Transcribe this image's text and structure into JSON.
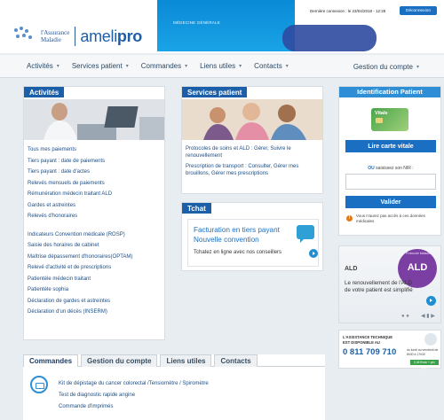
{
  "header": {
    "logo_line1": "l'Assurance",
    "logo_line2": "Maladie",
    "logo_brand_a": "ameli",
    "logo_brand_b": "pro",
    "specialty": "MÉDECINE GÉNÉRALE",
    "last_connection": "Dernière connexion : le 23/04/2018 - 12:26",
    "logout_label": "Déconnexion"
  },
  "nav": {
    "items": [
      {
        "label": "Activités"
      },
      {
        "label": "Services patient"
      },
      {
        "label": "Commandes"
      },
      {
        "label": "Liens utiles"
      },
      {
        "label": "Contacts"
      }
    ],
    "account_label": "Gestion du compte"
  },
  "activities": {
    "title": "Activités",
    "links": [
      "Tous mes paiements",
      "Tiers payant : date de paiements",
      "Tiers payant : date d'actes",
      "Relevés mensuels de paiements",
      "Rémunération médecin traitant ALD",
      "Gardes et astreintes",
      "Relevés d'honoraires"
    ],
    "links2": [
      "Indicateurs Convention médicale (ROSP)",
      "Saisie des horaires de cabinet",
      "Maîtrise dépassement d'honoraires(OPTAM)",
      "Relevé d'activité et de prescriptions",
      "Patientèle médecin traitant",
      "Patientèle sophia",
      "Déclaration de gardes et astreintes",
      "Déclaration d'un décès (INSERM)"
    ]
  },
  "services": {
    "title": "Services patient",
    "text1": "Protocoles de soins et ALD : Gérer, Suivre le renouvellement",
    "text2": "Prescription de transport : Consulter, Gérer mes brouillons, Gérer mes prescriptions"
  },
  "tchat": {
    "title": "Tchat",
    "line1": "Facturation en tiers payant",
    "line2": "Nouvelle convention",
    "line3": "Tchatez en ligne avec nos conseillers"
  },
  "identification": {
    "title": "Identification Patient",
    "card_label": "Vitale",
    "read_card_label": "Lire carte vitale",
    "or_word": "OU",
    "or_text": " saisissez son NIR :",
    "input_placeholder": "",
    "validate_label": "Valider",
    "warning": "Vous n'aurez pas accès à ces données médicales"
  },
  "ald": {
    "badge": "Protocole Maladie",
    "circle": "ALD",
    "title": "ALD",
    "text": "Le renouvellement de l'ALD de votre patient est simplifié",
    "dots": "● ●",
    "arrows": "◀ ▮ ▶"
  },
  "tech": {
    "line1": "L'ASSISTANCE TECHNIQUE",
    "line2": "EST DISPONIBLE AU",
    "phone": "0 811 709 710",
    "side": "du lundi au vendredi de 8h30 à 17h30",
    "price": "0,06 €/min + prix appel"
  },
  "bottom": {
    "tabs": [
      "Commandes",
      "Gestion du compte",
      "Liens utiles",
      "Contacts"
    ],
    "links": [
      "Kit de dépistage du cancer colorectal /Tensiomètre / Spiromètre",
      "Test de diagnostic rapide angine",
      "Commande d'imprimés"
    ]
  },
  "colors": {
    "accent": "#1b5fa8",
    "button": "#1a6fc2",
    "ald": "#7b3ea3",
    "vitale": "#4aa44a"
  }
}
